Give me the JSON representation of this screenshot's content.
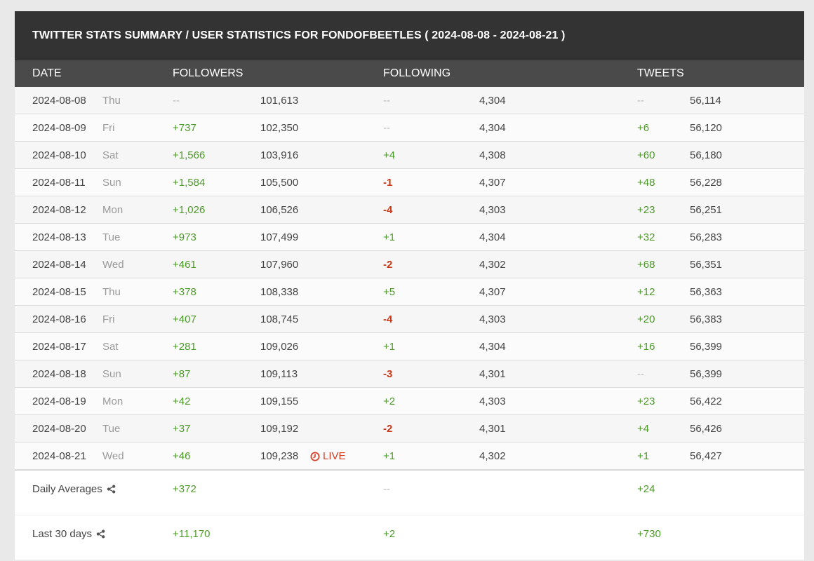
{
  "title": "TWITTER STATS SUMMARY / USER STATISTICS FOR FONDOFBEETLES ( 2024-08-08 - 2024-08-21 )",
  "headers": {
    "date": "DATE",
    "followers": "FOLLOWERS",
    "following": "FOLLOWING",
    "tweets": "TWEETS"
  },
  "colors": {
    "positive": "#4d9a2a",
    "negative": "#c8391a",
    "neutral": "#b8b8b8",
    "live": "#d64029"
  },
  "rows": [
    {
      "date": "2024-08-08",
      "dow": "Thu",
      "f_delta": "--",
      "f_total": "101,613",
      "g_delta": "--",
      "g_total": "4,304",
      "t_delta": "--",
      "t_total": "56,114"
    },
    {
      "date": "2024-08-09",
      "dow": "Fri",
      "f_delta": "+737",
      "f_total": "102,350",
      "g_delta": "--",
      "g_total": "4,304",
      "t_delta": "+6",
      "t_total": "56,120"
    },
    {
      "date": "2024-08-10",
      "dow": "Sat",
      "f_delta": "+1,566",
      "f_total": "103,916",
      "g_delta": "+4",
      "g_total": "4,308",
      "t_delta": "+60",
      "t_total": "56,180"
    },
    {
      "date": "2024-08-11",
      "dow": "Sun",
      "f_delta": "+1,584",
      "f_total": "105,500",
      "g_delta": "-1",
      "g_total": "4,307",
      "t_delta": "+48",
      "t_total": "56,228"
    },
    {
      "date": "2024-08-12",
      "dow": "Mon",
      "f_delta": "+1,026",
      "f_total": "106,526",
      "g_delta": "-4",
      "g_total": "4,303",
      "t_delta": "+23",
      "t_total": "56,251"
    },
    {
      "date": "2024-08-13",
      "dow": "Tue",
      "f_delta": "+973",
      "f_total": "107,499",
      "g_delta": "+1",
      "g_total": "4,304",
      "t_delta": "+32",
      "t_total": "56,283"
    },
    {
      "date": "2024-08-14",
      "dow": "Wed",
      "f_delta": "+461",
      "f_total": "107,960",
      "g_delta": "-2",
      "g_total": "4,302",
      "t_delta": "+68",
      "t_total": "56,351"
    },
    {
      "date": "2024-08-15",
      "dow": "Thu",
      "f_delta": "+378",
      "f_total": "108,338",
      "g_delta": "+5",
      "g_total": "4,307",
      "t_delta": "+12",
      "t_total": "56,363"
    },
    {
      "date": "2024-08-16",
      "dow": "Fri",
      "f_delta": "+407",
      "f_total": "108,745",
      "g_delta": "-4",
      "g_total": "4,303",
      "t_delta": "+20",
      "t_total": "56,383"
    },
    {
      "date": "2024-08-17",
      "dow": "Sat",
      "f_delta": "+281",
      "f_total": "109,026",
      "g_delta": "+1",
      "g_total": "4,304",
      "t_delta": "+16",
      "t_total": "56,399"
    },
    {
      "date": "2024-08-18",
      "dow": "Sun",
      "f_delta": "+87",
      "f_total": "109,113",
      "g_delta": "-3",
      "g_total": "4,301",
      "t_delta": "--",
      "t_total": "56,399"
    },
    {
      "date": "2024-08-19",
      "dow": "Mon",
      "f_delta": "+42",
      "f_total": "109,155",
      "g_delta": "+2",
      "g_total": "4,303",
      "t_delta": "+23",
      "t_total": "56,422"
    },
    {
      "date": "2024-08-20",
      "dow": "Tue",
      "f_delta": "+37",
      "f_total": "109,192",
      "g_delta": "-2",
      "g_total": "4,301",
      "t_delta": "+4",
      "t_total": "56,426"
    },
    {
      "date": "2024-08-21",
      "dow": "Wed",
      "f_delta": "+46",
      "f_total": "109,238",
      "live": "LIVE",
      "live_icon": "clock-icon",
      "g_delta": "+1",
      "g_total": "4,302",
      "t_delta": "+1",
      "t_total": "56,427"
    }
  ],
  "footer": [
    {
      "label": "Daily Averages",
      "icon": "share-icon",
      "f_delta": "+372",
      "g_delta": "--",
      "t_delta": "+24"
    },
    {
      "label": "Last 30 days",
      "icon": "share-icon",
      "f_delta": "+11,170",
      "g_delta": "+2",
      "t_delta": "+730"
    }
  ]
}
